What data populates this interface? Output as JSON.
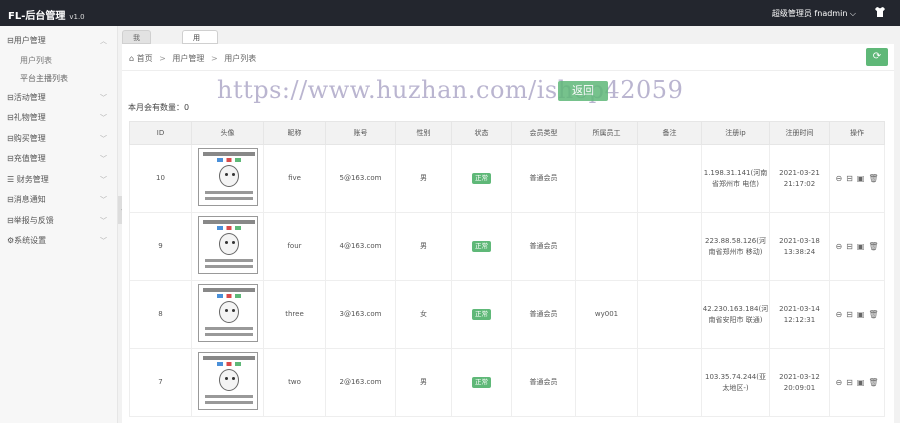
{
  "header": {
    "title": "FL-后台管理",
    "version": "v1.0",
    "user": "超级管理员 fnadmin ⌵",
    "shirt_icon": "shirt-icon"
  },
  "sidebar": {
    "items": [
      {
        "label": "⊟用户管理",
        "chevron": "︿",
        "expanded": true,
        "children": [
          "用户列表",
          "平台主播列表"
        ]
      },
      {
        "label": "⊟活动管理",
        "chevron": "﹀"
      },
      {
        "label": "⊟礼物管理",
        "chevron": "﹀"
      },
      {
        "label": "⊟购买管理",
        "chevron": "﹀"
      },
      {
        "label": "⊟充值管理",
        "chevron": "﹀"
      },
      {
        "label": "☰ 财务管理",
        "chevron": "﹀"
      },
      {
        "label": "⊟消息通知",
        "chevron": "﹀"
      },
      {
        "label": "⊟举报与反馈",
        "chevron": "﹀"
      },
      {
        "label": "⚙系统设置",
        "chevron": "﹀"
      }
    ]
  },
  "tabs": [
    {
      "label": "我的桌面"
    },
    {
      "label": "用户列表",
      "close": "×"
    }
  ],
  "breadcrumb": {
    "home_icon": "home-icon",
    "items": [
      "首页",
      "用户管理",
      "用户列表"
    ],
    "sep": ">"
  },
  "refresh_icon": "⟳",
  "watermark": {
    "text": "https://www.huzhan.com/ishop42059",
    "badge": "返回"
  },
  "count_text": "本月会有数量：0",
  "table": {
    "headers": [
      "ID",
      "头像",
      "昵称",
      "账号",
      "性别",
      "状态",
      "会员类型",
      "所属员工",
      "备注",
      "注册ip",
      "注册时间",
      "操作"
    ],
    "rows": [
      {
        "id": "10",
        "nick": "five",
        "account": "5@163.com",
        "gender": "男",
        "status": "正常",
        "member": "普通会员",
        "staff": "",
        "note": "",
        "ip": "1.198.31.141(河南省郑州市 电信)",
        "time": "2021-03-21 21:17:02"
      },
      {
        "id": "9",
        "nick": "four",
        "account": "4@163.com",
        "gender": "男",
        "status": "正常",
        "member": "普通会员",
        "staff": "",
        "note": "",
        "ip": "223.88.58.126(河南省郑州市 移动)",
        "time": "2021-03-18 13:38:24"
      },
      {
        "id": "8",
        "nick": "three",
        "account": "3@163.com",
        "gender": "女",
        "status": "正常",
        "member": "普通会员",
        "staff": "wy001",
        "note": "",
        "ip": "42.230.163.184(河南省安阳市 联通)",
        "time": "2021-03-14 12:12:31"
      },
      {
        "id": "7",
        "nick": "two",
        "account": "2@163.com",
        "gender": "男",
        "status": "正常",
        "member": "普通会员",
        "staff": "",
        "note": "",
        "ip": "103.35.74.244(亚太地区-)",
        "time": "2021-03-12 20:09:01"
      }
    ],
    "ops_icons": [
      "⊖",
      "⊟",
      "▣",
      "🗑"
    ]
  },
  "colors": {
    "topbar": "#23262e",
    "accent": "#5fb878"
  }
}
